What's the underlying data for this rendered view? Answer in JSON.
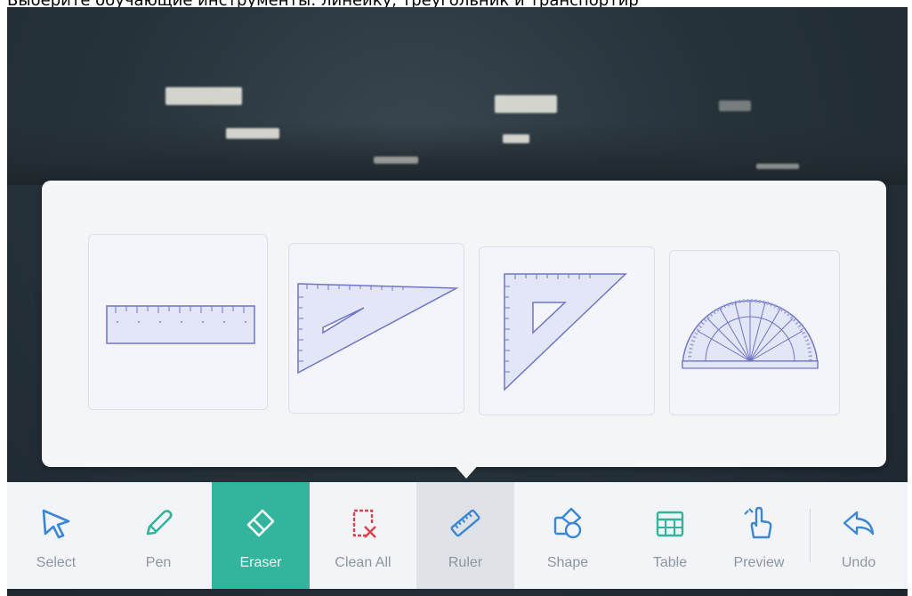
{
  "caption": "Выберите обучающие инструменты: линейку, треугольник и транспортир",
  "popup": {
    "title": "",
    "tools": [
      {
        "name": "ruler",
        "icon": "ruler-icon"
      },
      {
        "name": "right-triangle-30",
        "icon": "triangle-ruler-icon"
      },
      {
        "name": "right-triangle-45",
        "icon": "set-square-icon"
      },
      {
        "name": "protractor",
        "icon": "protractor-icon"
      }
    ]
  },
  "toolbar": {
    "items": [
      {
        "label": "Select",
        "icon": "cursor-icon"
      },
      {
        "label": "Pen",
        "icon": "pen-icon"
      },
      {
        "label": "Eraser",
        "icon": "eraser-icon",
        "state": "active"
      },
      {
        "label": "Clean All",
        "icon": "clean-all-icon"
      },
      {
        "label": "Ruler",
        "icon": "ruler-icon",
        "state": "hover"
      },
      {
        "label": "Shape",
        "icon": "shape-icon"
      },
      {
        "label": "Table",
        "icon": "table-icon"
      },
      {
        "label": "Preview",
        "icon": "preview-touch-icon"
      },
      {
        "label": "Undo",
        "icon": "undo-icon"
      }
    ]
  },
  "colors": {
    "accent": "#33b49d",
    "icon_blue": "#3b87d6",
    "icon_red": "#d2474e",
    "tool_stroke": "#6e75c8",
    "label_gray": "#8d96a0"
  }
}
